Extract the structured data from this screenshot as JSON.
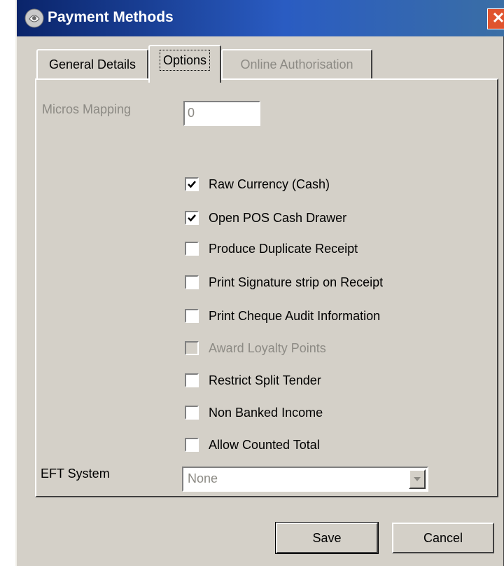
{
  "window": {
    "title": "Payment Methods",
    "close_label": "✕"
  },
  "tabs": [
    {
      "label": "General Details",
      "state": "normal"
    },
    {
      "label": "Options",
      "state": "selected"
    },
    {
      "label": "Online Authorisation",
      "state": "disabled"
    }
  ],
  "options": {
    "micros_mapping_label": "Micros Mapping",
    "micros_mapping_value": "0",
    "checkboxes": [
      {
        "label": "Raw Currency (Cash)",
        "checked": true,
        "enabled": true
      },
      {
        "label": "Open POS Cash Drawer",
        "checked": true,
        "enabled": true
      },
      {
        "label": "Produce Duplicate Receipt",
        "checked": false,
        "enabled": true
      },
      {
        "label": "Print Signature strip on Receipt",
        "checked": false,
        "enabled": true
      },
      {
        "label": "Print Cheque Audit Information",
        "checked": false,
        "enabled": true
      },
      {
        "label": "Award Loyalty Points",
        "checked": false,
        "enabled": false
      },
      {
        "label": "Restrict Split Tender",
        "checked": false,
        "enabled": true
      },
      {
        "label": "Non Banked Income",
        "checked": false,
        "enabled": true
      },
      {
        "label": "Allow Counted Total",
        "checked": false,
        "enabled": true
      }
    ],
    "eft_system_label": "EFT System",
    "eft_system_value": "None"
  },
  "buttons": {
    "save_label": "Save",
    "cancel_label": "Cancel"
  },
  "colors": {
    "title_bar": "#0a246a",
    "dialog_face": "#d4d0c8",
    "disabled_text": "#8c8a84"
  }
}
